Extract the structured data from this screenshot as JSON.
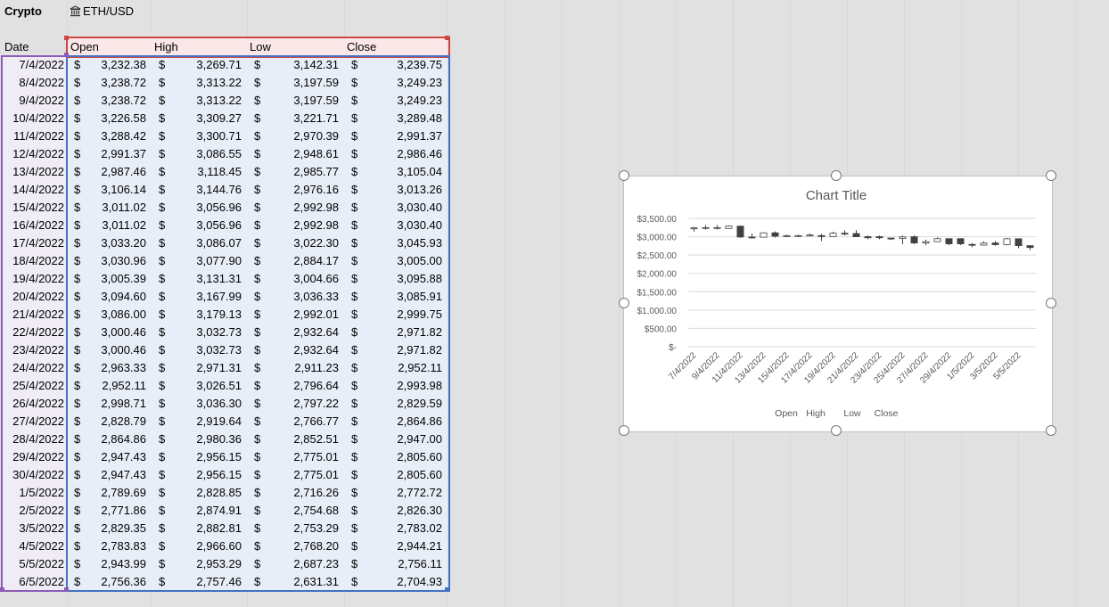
{
  "sheet": {
    "label_crypto": "Crypto",
    "stock_icon": "bank-icon",
    "stock_symbol": "ETH/USD",
    "headers": [
      "Date",
      "Open",
      "High",
      "Low",
      "Close"
    ],
    "currency_symbol": "$",
    "rows": [
      [
        "7/4/2022",
        "3,232.38",
        "3,269.71",
        "3,142.31",
        "3,239.75"
      ],
      [
        "8/4/2022",
        "3,238.72",
        "3,313.22",
        "3,197.59",
        "3,249.23"
      ],
      [
        "9/4/2022",
        "3,238.72",
        "3,313.22",
        "3,197.59",
        "3,249.23"
      ],
      [
        "10/4/2022",
        "3,226.58",
        "3,309.27",
        "3,221.71",
        "3,289.48"
      ],
      [
        "11/4/2022",
        "3,288.42",
        "3,300.71",
        "2,970.39",
        "2,991.37"
      ],
      [
        "12/4/2022",
        "2,991.37",
        "3,086.55",
        "2,948.61",
        "2,986.46"
      ],
      [
        "13/4/2022",
        "2,987.46",
        "3,118.45",
        "2,985.77",
        "3,105.04"
      ],
      [
        "14/4/2022",
        "3,106.14",
        "3,144.76",
        "2,976.16",
        "3,013.26"
      ],
      [
        "15/4/2022",
        "3,011.02",
        "3,056.96",
        "2,992.98",
        "3,030.40"
      ],
      [
        "16/4/2022",
        "3,011.02",
        "3,056.96",
        "2,992.98",
        "3,030.40"
      ],
      [
        "17/4/2022",
        "3,033.20",
        "3,086.07",
        "3,022.30",
        "3,045.93"
      ],
      [
        "18/4/2022",
        "3,030.96",
        "3,077.90",
        "2,884.17",
        "3,005.00"
      ],
      [
        "19/4/2022",
        "3,005.39",
        "3,131.31",
        "3,004.66",
        "3,095.88"
      ],
      [
        "20/4/2022",
        "3,094.60",
        "3,167.99",
        "3,036.33",
        "3,085.91"
      ],
      [
        "21/4/2022",
        "3,086.00",
        "3,179.13",
        "2,992.01",
        "2,999.75"
      ],
      [
        "22/4/2022",
        "3,000.46",
        "3,032.73",
        "2,932.64",
        "2,971.82"
      ],
      [
        "23/4/2022",
        "3,000.46",
        "3,032.73",
        "2,932.64",
        "2,971.82"
      ],
      [
        "24/4/2022",
        "2,963.33",
        "2,971.31",
        "2,911.23",
        "2,952.11"
      ],
      [
        "25/4/2022",
        "2,952.11",
        "3,026.51",
        "2,796.64",
        "2,993.98"
      ],
      [
        "26/4/2022",
        "2,998.71",
        "3,036.30",
        "2,797.22",
        "2,829.59"
      ],
      [
        "27/4/2022",
        "2,828.79",
        "2,919.64",
        "2,766.77",
        "2,864.86"
      ],
      [
        "28/4/2022",
        "2,864.86",
        "2,980.36",
        "2,852.51",
        "2,947.00"
      ],
      [
        "29/4/2022",
        "2,947.43",
        "2,956.15",
        "2,775.01",
        "2,805.60"
      ],
      [
        "30/4/2022",
        "2,947.43",
        "2,956.15",
        "2,775.01",
        "2,805.60"
      ],
      [
        "1/5/2022",
        "2,789.69",
        "2,828.85",
        "2,716.26",
        "2,772.72"
      ],
      [
        "2/5/2022",
        "2,771.86",
        "2,874.91",
        "2,754.68",
        "2,826.30"
      ],
      [
        "3/5/2022",
        "2,829.35",
        "2,882.81",
        "2,753.29",
        "2,783.02"
      ],
      [
        "4/5/2022",
        "2,783.83",
        "2,966.60",
        "2,768.20",
        "2,944.21"
      ],
      [
        "5/5/2022",
        "2,943.99",
        "2,953.29",
        "2,687.23",
        "2,756.11"
      ],
      [
        "6/5/2022",
        "2,756.36",
        "2,757.46",
        "2,631.31",
        "2,704.93"
      ]
    ]
  },
  "chart_data": {
    "type": "candlestick",
    "title": "Chart Title",
    "y_tick_labels": [
      "$3,500.00",
      "$3,000.00",
      "$2,500.00",
      "$2,000.00",
      "$1,500.00",
      "$1,000.00",
      "$500.00",
      "$-"
    ],
    "ylim": [
      0,
      3500
    ],
    "x_tick_labels": [
      "7/4/2022",
      "9/4/2022",
      "11/4/2022",
      "13/4/2022",
      "15/4/2022",
      "17/4/2022",
      "19/4/2022",
      "21/4/2022",
      "23/4/2022",
      "25/4/2022",
      "27/4/2022",
      "29/4/2022",
      "1/5/2022",
      "3/5/2022",
      "5/5/2022"
    ],
    "legend": [
      "Open",
      "High",
      "Low",
      "Close"
    ],
    "legend_position": "bottom",
    "grid": true,
    "up_color": "#ffffff",
    "down_color": "#404040"
  }
}
